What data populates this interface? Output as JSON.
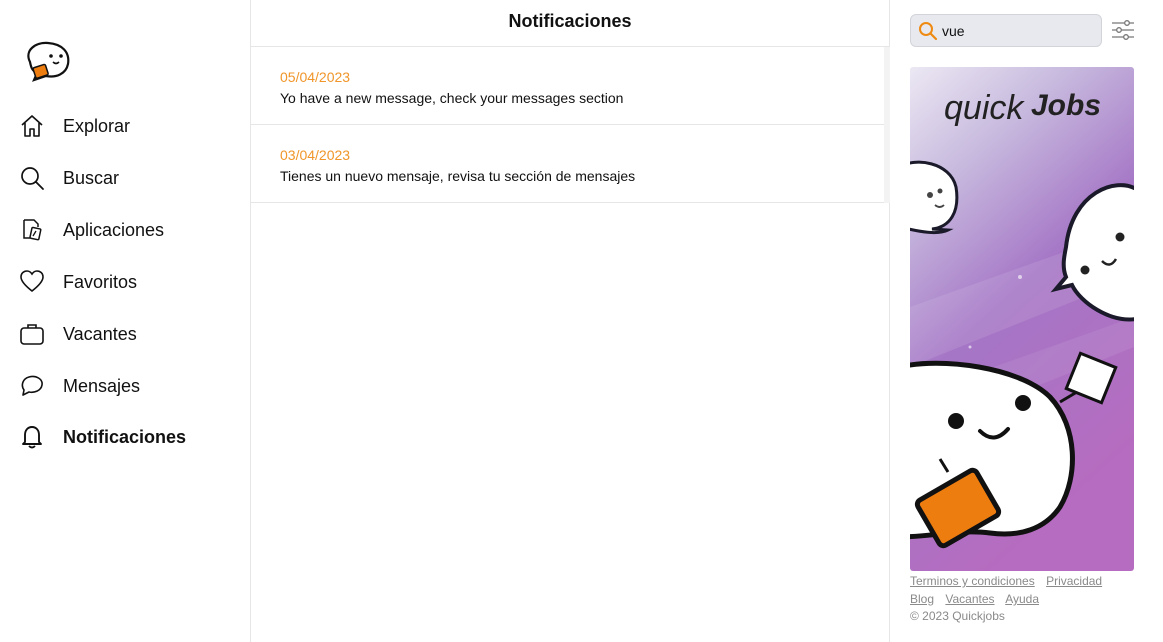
{
  "sidebar": {
    "items": [
      {
        "label": "Explorar",
        "icon": "home-icon"
      },
      {
        "label": "Buscar",
        "icon": "search-icon"
      },
      {
        "label": "Aplicaciones",
        "icon": "applications-icon"
      },
      {
        "label": "Favoritos",
        "icon": "heart-icon"
      },
      {
        "label": "Vacantes",
        "icon": "briefcase-icon"
      },
      {
        "label": "Mensajes",
        "icon": "chat-icon"
      },
      {
        "label": "Notificaciones",
        "icon": "bell-icon",
        "active": true
      }
    ]
  },
  "main": {
    "title": "Notificaciones",
    "notifications": [
      {
        "date": "05/04/2023",
        "message": "Yo have a new message, check your messages section"
      },
      {
        "date": "03/04/2023",
        "message": "Tienes un nuevo mensaje, revisa tu sección de mensajes"
      }
    ]
  },
  "right": {
    "search": {
      "value": "vue",
      "icon": "search-icon"
    },
    "filter_icon": "sliders-icon",
    "banner": {
      "brand_light": "quick",
      "brand_bold": "Jobs"
    },
    "footer": {
      "links_row1": [
        "Terminos y condiciones",
        "Privacidad"
      ],
      "links_row2": [
        "Blog",
        "Vacantes",
        "Ayuda"
      ],
      "copyright": "© 2023 Quickjobs"
    }
  },
  "colors": {
    "accent": "#f0962a",
    "mascot_orange": "#ee7d10",
    "banner_purple": "#b06cc0"
  }
}
